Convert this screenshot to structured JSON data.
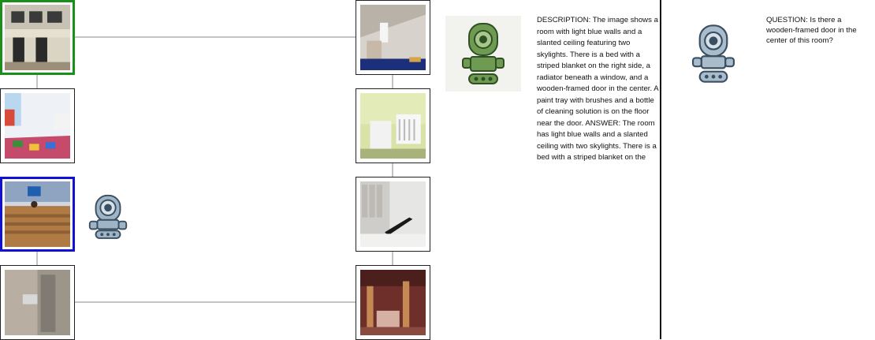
{
  "left_panel": {
    "images": [
      {
        "id": "computer-lab",
        "scene": "computer lab with desks and chairs",
        "selected": "green"
      },
      {
        "id": "attic-room",
        "scene": "attic room with slanted ceiling"
      },
      {
        "id": "playroom",
        "scene": "children playroom with colorful rug"
      },
      {
        "id": "nursery",
        "scene": "nursery with crib and changing table"
      },
      {
        "id": "reception",
        "scene": "reception desk lobby",
        "selected": "blue"
      },
      {
        "id": "locker-room",
        "scene": "locker room with bench"
      },
      {
        "id": "shower",
        "scene": "tiled shower room"
      },
      {
        "id": "basement",
        "scene": "basement with wooden posts"
      }
    ],
    "colors": {
      "selected_green": "#1a8f1a",
      "selected_blue": "#1010d8",
      "connector": "#888888"
    }
  },
  "agents": {
    "describer": {
      "icon": "robot-icon",
      "color": "#5f8f4a"
    },
    "questioner": {
      "icon": "robot-icon",
      "color": "#6f8fa6"
    }
  },
  "description_text": "DESCRIPTION: The image shows a room with light blue walls and a slanted ceiling featuring two skylights. There is a bed with a striped blanket on the right side, a radiator beneath a window, and a wooden-framed door in the center. A paint tray with brushes and a bottle of cleaning solution is on the floor near the door.  ANSWER: The room has light blue walls and a slanted ceiling with two skylights. There is a bed with a striped blanket on the",
  "question_text": "QUESTION: Is there a wooden-framed door in the center of this room?"
}
